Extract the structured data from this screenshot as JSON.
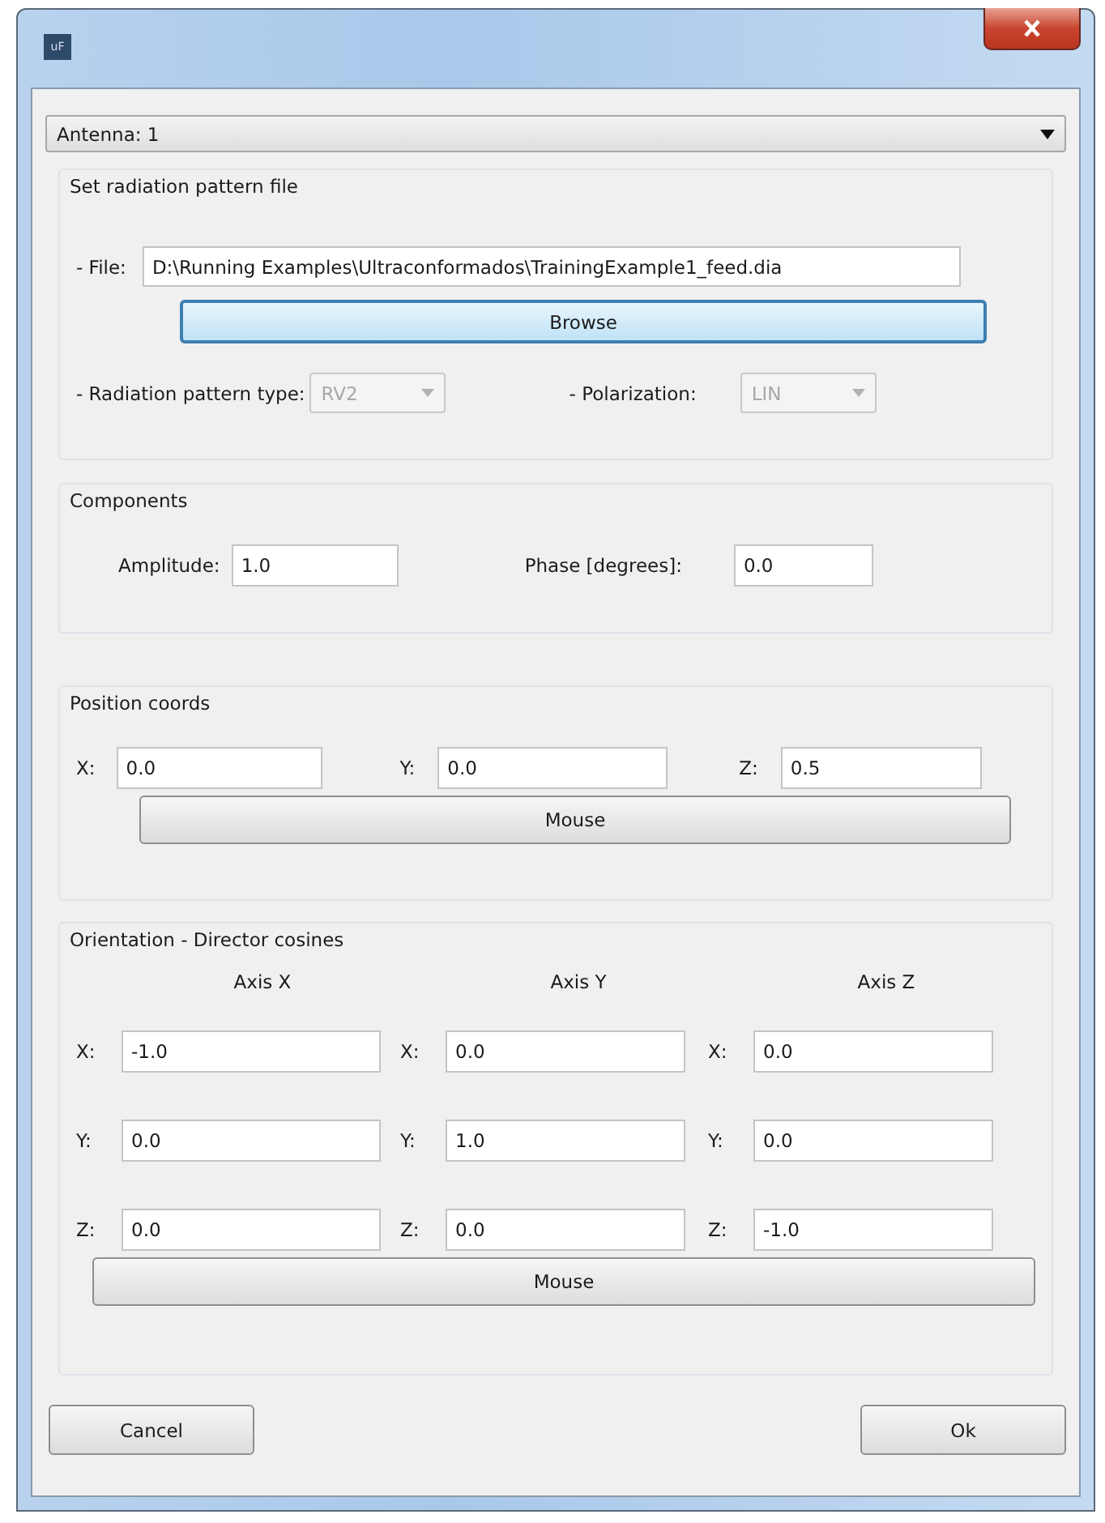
{
  "window": {
    "icon_text": "uF"
  },
  "antenna_select": {
    "value": "Antenna: 1"
  },
  "radiation_file": {
    "title": "Set radiation pattern file",
    "file_label": "- File:",
    "file_value": "D:\\Running Examples\\Ultraconformados\\TrainingExample1_feed.dia",
    "browse_button": {
      "label": "Browse",
      "focused": true
    },
    "pattern_type": {
      "label": "- Radiation pattern type:",
      "value": "RV2",
      "disabled": true
    },
    "polarization": {
      "label": "- Polarization:",
      "value": "LIN",
      "disabled": true
    }
  },
  "components": {
    "title": "Components",
    "fields": [
      {
        "label": "Amplitude:",
        "value": "1.0"
      },
      {
        "label": "Phase [degrees]:",
        "value": "0.0"
      }
    ]
  },
  "position": {
    "title": "Position coords",
    "fields": [
      {
        "label": "X:",
        "value": "0.0"
      },
      {
        "label": "Y:",
        "value": "0.0"
      },
      {
        "label": "Z:",
        "value": "0.5"
      }
    ],
    "button": "Mouse"
  },
  "orientation": {
    "title": "Orientation - Director cosines",
    "axes": [
      {
        "heading": "Axis X",
        "fields": [
          {
            "label": "X:",
            "value": "-1.0"
          },
          {
            "label": "Y:",
            "value": "0.0"
          },
          {
            "label": "Z:",
            "value": "0.0"
          }
        ]
      },
      {
        "heading": "Axis Y",
        "fields": [
          {
            "label": "X:",
            "value": "0.0"
          },
          {
            "label": "Y:",
            "value": "1.0"
          },
          {
            "label": "Z:",
            "value": "0.0"
          }
        ]
      },
      {
        "heading": "Axis Z",
        "fields": [
          {
            "label": "X:",
            "value": "0.0"
          },
          {
            "label": "Y:",
            "value": "0.0"
          },
          {
            "label": "Z:",
            "value": "-1.0"
          }
        ]
      }
    ],
    "button": "Mouse"
  },
  "buttons": [
    {
      "label": "Cancel"
    },
    {
      "label": "Ok"
    }
  ]
}
